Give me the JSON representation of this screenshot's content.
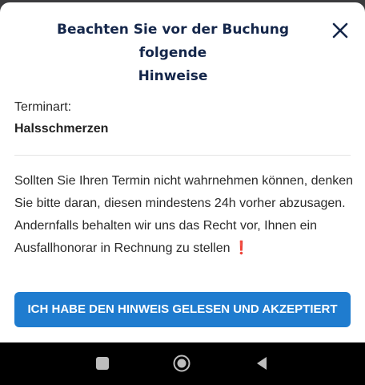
{
  "dialog": {
    "title_line1": "Beachten Sie vor der Buchung folgende",
    "title_line2": "Hinweise",
    "close_icon": "close-icon"
  },
  "appointment": {
    "type_label": "Terminart:",
    "type_value": "Halsschmerzen"
  },
  "notice": {
    "text": "Sollten Sie Ihren Termin nicht wahrnehmen können, denken Sie bitte daran, diesen mindestens 24h vorher abzusagen. Andernfalls behalten wir uns das Recht vor, Ihnen ein Ausfallhonorar in Rechnung zu stellen",
    "emoji": "❗"
  },
  "accept_button": {
    "label": "ICH HABE DEN HINWEIS GELESEN UND AKZEPTIERT"
  },
  "colors": {
    "title": "#14264a",
    "button": "#1f7ccf",
    "exclamation": "#e0242e"
  },
  "navbar": {
    "icons": [
      "recent-apps-icon",
      "home-icon",
      "back-icon"
    ]
  }
}
